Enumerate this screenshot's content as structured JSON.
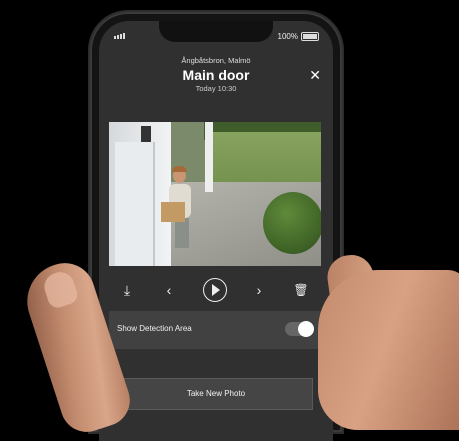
{
  "status_bar": {
    "battery": "100%"
  },
  "header": {
    "location": "Ångbåtsbron, Malmö",
    "title": "Main door",
    "subtitle": "Today 10:30"
  },
  "icons": {
    "close": "close-icon",
    "download": "download-icon",
    "prev": "chevron-left-icon",
    "play": "play-icon",
    "next": "chevron-right-icon",
    "delete": "trash-icon"
  },
  "detection": {
    "label": "Show Detection Area",
    "enabled": true
  },
  "take_photo_label": "Take New Photo"
}
